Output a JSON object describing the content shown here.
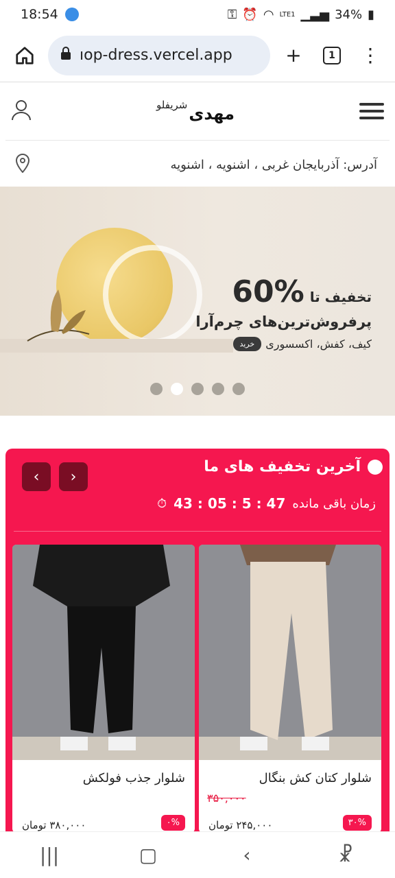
{
  "status_bar": {
    "time": "18:54",
    "battery": "34%",
    "network": "LTE1"
  },
  "browser": {
    "url": "ıop-dress.vercel.app",
    "tab_count": "1"
  },
  "header": {
    "brand_main": "مهدی",
    "brand_sub": "شریفلو"
  },
  "address": {
    "text": "آدرس: آذربایجان غربی ، اشنویه ، اشنویه"
  },
  "banner": {
    "percent": "60%",
    "discount_prefix": "تخفیف تا",
    "title": "پرفروش‌ترین‌های چرم‌آرا",
    "subtitle": "کیف، کفش، اکسسوری",
    "cta": "خرید",
    "dots_count": 5,
    "active_dot_index": 1
  },
  "deals": {
    "title": "آخرین تخفیف های ما",
    "timer_label": "زمان باقی مانده",
    "timer_value": "47 : 5 : 05 : 43",
    "products": [
      {
        "name": "شلوار کتان کش بنگال",
        "old_price": "۳۵۰,۰۰۰",
        "price": "۲۴۵,۰۰۰ تومان",
        "badge": "۳۰%"
      },
      {
        "name": "شلوار جذب فولکش",
        "old_price": "",
        "price": "۳۸۰,۰۰۰ تومان",
        "badge": "۰%"
      }
    ]
  },
  "colors": {
    "accent": "#f5174f",
    "arrow_bg": "#7a0d24"
  }
}
